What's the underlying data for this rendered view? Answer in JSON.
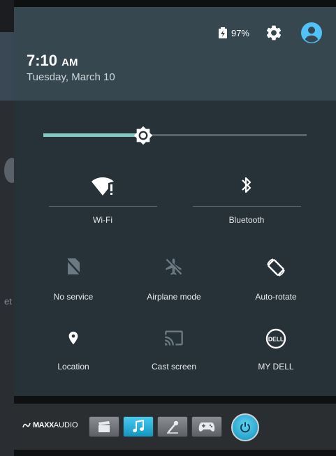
{
  "status": {
    "battery_percent": "97%",
    "icons": [
      "battery-charging-icon",
      "gear-icon",
      "account-icon"
    ]
  },
  "header": {
    "time": "7:10",
    "ampm": "AM",
    "date": "Tuesday, March 10"
  },
  "brightness": {
    "level": 0.38
  },
  "tiles": {
    "wifi": {
      "label": "Wi-Fi",
      "icon": "wifi-alert-icon"
    },
    "bluetooth": {
      "label": "Bluetooth",
      "icon": "bluetooth-icon"
    },
    "no_service": {
      "label": "No service",
      "icon": "no-sim-icon"
    },
    "airplane": {
      "label": "Airplane mode",
      "icon": "airplane-icon"
    },
    "auto_rotate": {
      "label": "Auto-rotate",
      "icon": "rotate-icon"
    },
    "location": {
      "label": "Location",
      "icon": "location-pin-icon"
    },
    "cast": {
      "label": "Cast screen",
      "icon": "cast-icon"
    },
    "my_dell": {
      "label": "MY DELL",
      "icon": "dell-logo-icon"
    }
  },
  "maxx": {
    "brand_bold": "MAXX",
    "brand_light": "AUDIO",
    "buttons": [
      "movie-icon",
      "music-icon",
      "microphone-icon",
      "gamepad-icon"
    ],
    "active_button": "music-icon",
    "power": "power-icon"
  },
  "colors": {
    "shade_bg": "#263238",
    "header_bg": "#37474f",
    "accent": "#80cbc4",
    "avatar": "#4fc3f7",
    "disabled_icon": "#6b7a82"
  }
}
